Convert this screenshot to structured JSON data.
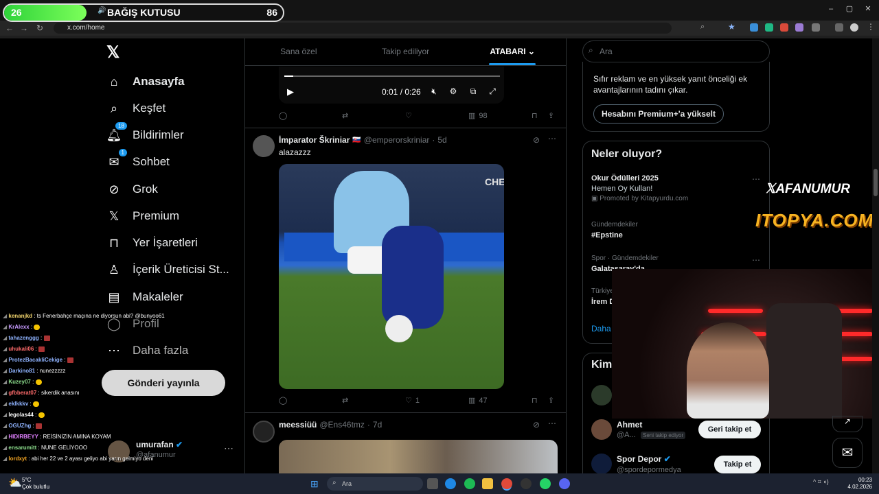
{
  "donation": {
    "left_value": "26",
    "title": "BAĞIŞ KUTUSU",
    "right_value": "86"
  },
  "browser": {
    "url": "x.com/home"
  },
  "nav": {
    "items": [
      {
        "label": "Anasayfa",
        "icon": "home-icon",
        "bold": true
      },
      {
        "label": "Keşfet",
        "icon": "search-icon"
      },
      {
        "label": "Bildirimler",
        "icon": "bell-icon",
        "badge": "18"
      },
      {
        "label": "Sohbet",
        "icon": "mail-icon",
        "badge": "1"
      },
      {
        "label": "Grok",
        "icon": "grok-icon"
      },
      {
        "label": "Premium",
        "icon": "x-icon"
      },
      {
        "label": "Yer İşaretleri",
        "icon": "bookmark-icon"
      },
      {
        "label": "İçerik Üreticisi St...",
        "icon": "creator-icon"
      },
      {
        "label": "Makaleler",
        "icon": "article-icon"
      },
      {
        "label": "Profil",
        "icon": "profile-icon"
      },
      {
        "label": "Daha fazla",
        "icon": "more-icon"
      }
    ],
    "post_button": "Gönderi yayınla"
  },
  "profile": {
    "name": "umurafan",
    "handle": "@afanumur"
  },
  "timeline": {
    "tabs": [
      "Sana özel",
      "Takip ediliyor",
      "ATABARI"
    ],
    "video": {
      "time": "0:01 / 0:26",
      "progress": 0.04
    },
    "post0_actions": {
      "views": "98"
    },
    "post1": {
      "name": "İmparator Škriniar",
      "handle": "@emperorskriniar",
      "time": "5d",
      "text": "alazazzz",
      "likes": "1",
      "views": "47",
      "media_label": "CHE"
    },
    "post2": {
      "name": "meessiüü",
      "handle": "@Ens46tmz",
      "time": "7d"
    }
  },
  "search": {
    "placeholder": "Ara"
  },
  "premium": {
    "text": "Sıfır reklam ve en yüksek yanıt önceliği ek avantajlarının tadını çıkar.",
    "button": "Hesabını Premium+'a yükselt"
  },
  "trends": {
    "title": "Neler oluyor?",
    "items": [
      {
        "category": "",
        "name": "Okur Ödülleri 2025",
        "sub": "Hemen Oy Kullan!",
        "promoted": "Promoted by Kitapyurdu.com"
      },
      {
        "category": "Gündemdekiler",
        "name": "#Epstine"
      },
      {
        "category": "Spor · Gündemdekiler",
        "name": "Galatasaray'da"
      },
      {
        "category": "Türkiye",
        "name": "İrem D"
      }
    ],
    "more": "Daha"
  },
  "who": {
    "title": "Kimi",
    "items": [
      {
        "name": "Ahmet",
        "handle": "@A...",
        "note": "Seni takip ediyor",
        "button": "Geri takip et"
      },
      {
        "name": "Spor Depor",
        "handle": "@spordepormedya",
        "button": "Takip et"
      }
    ]
  },
  "overlay": {
    "xafanumur": "AFANUMUR",
    "itopya": "ITOPYA.COM"
  },
  "chat": [
    {
      "user": "kenanjkd",
      "color": "#f5d76e",
      "msg": ": ts Fenerbahçe maçına ne diyorsun abi? @bunyoo61"
    },
    {
      "user": "KrAlexx",
      "color": "#c79bff",
      "msg": ":",
      "emote": "y"
    },
    {
      "user": "tahazenggg",
      "color": "#8fb3ff",
      "msg": ":",
      "emote": "r"
    },
    {
      "user": "uhukali06",
      "color": "#ff6b6b",
      "msg": ":",
      "emote": "r"
    },
    {
      "user": "ProtezBacakliCekige",
      "color": "#8fb3ff",
      "msg": ":",
      "emote": "r"
    },
    {
      "user": "Darkino81",
      "color": "#8fb3ff",
      "msg": ": nunezzzzz"
    },
    {
      "user": "Kuzey07",
      "color": "#8ee08e",
      "msg": ":",
      "emote": "y"
    },
    {
      "user": "gfbberat07",
      "color": "#ff6b6b",
      "msg": ": sikerdik anasını"
    },
    {
      "user": "eklkkkv",
      "color": "#8fb3ff",
      "msg": ":",
      "emote": "y"
    },
    {
      "user": "legolas44",
      "color": "#ffffff",
      "msg": ":",
      "emote": "y"
    },
    {
      "user": "OGUZhg",
      "color": "#8fb3ff",
      "msg": ":",
      "emote": "r"
    },
    {
      "user": "HIDIRBEYY",
      "color": "#e080ff",
      "msg": ": REİSİNİZİN AMINA KOYAM"
    },
    {
      "user": "ensarumitt",
      "color": "#8ee08e",
      "msg": ": NUNE GELİYOOO"
    },
    {
      "user": "lordxyt",
      "color": "#f5a623",
      "msg": ": abi her 22 ve 2 ayası geliyo abi yarın gelmiyo deni"
    }
  ],
  "taskbar": {
    "temp": "5°C",
    "weather": "Çok bulutlu",
    "search": "Ara",
    "time": "00:23",
    "date": "4.02.2026"
  }
}
